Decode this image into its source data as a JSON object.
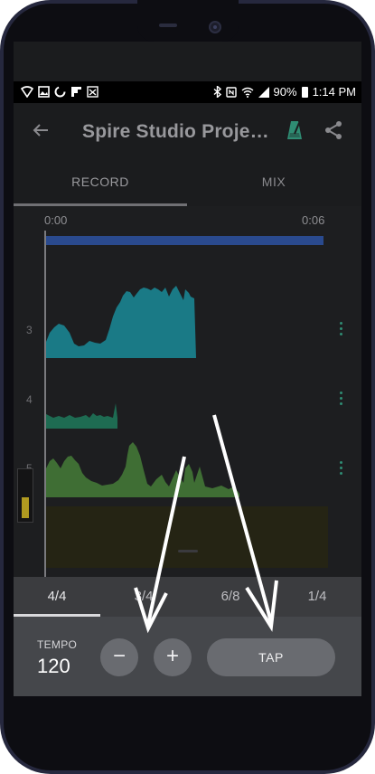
{
  "status_bar": {
    "right_text": "90%",
    "time": "1:14 PM",
    "icons": [
      "wifi-shield-icon",
      "image-icon",
      "sync-icon",
      "flipboard-icon",
      "voicemail-icon",
      "bluetooth-icon",
      "nfc-icon",
      "wifi-icon",
      "signal-icon",
      "battery-icon"
    ]
  },
  "app_bar": {
    "title": "Spire Studio Project…",
    "icons": [
      "back-arrow-icon",
      "metronome-icon",
      "share-icon"
    ],
    "accent_color": "#2f8c73"
  },
  "tabs": [
    {
      "label": "RECORD",
      "active": true
    },
    {
      "label": "MIX",
      "active": false
    }
  ],
  "timeline": {
    "start_time": "0:00",
    "end_time": "0:06",
    "tracks": [
      {
        "number": "3",
        "color": "#1a7a86"
      },
      {
        "number": "4",
        "color": "#1e6b52"
      },
      {
        "number": "5",
        "color": "#3f6e34"
      }
    ],
    "level_meter_fraction": 0.45
  },
  "time_signatures": [
    {
      "label": "4/4",
      "active": true
    },
    {
      "label": "3/4",
      "active": false
    },
    {
      "label": "6/8",
      "active": false
    },
    {
      "label": "1/4",
      "active": false
    }
  ],
  "tempo": {
    "label": "TEMPO",
    "value": "120",
    "decrement_symbol": "−",
    "increment_symbol": "+",
    "tap_label": "TAP"
  }
}
